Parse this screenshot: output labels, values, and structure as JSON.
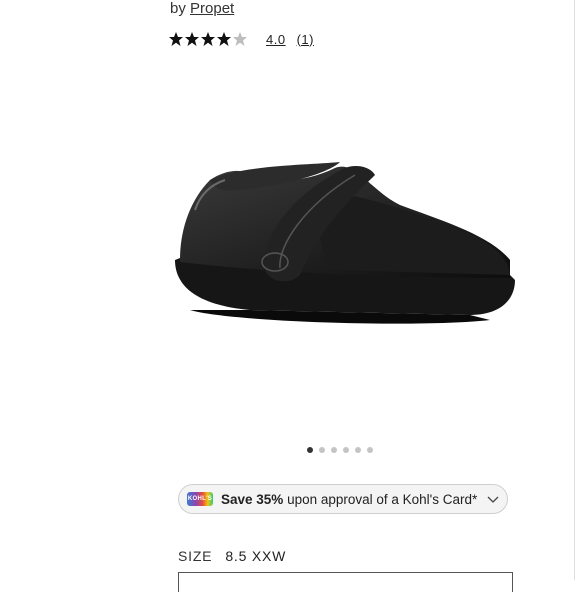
{
  "product": {
    "by_prefix": "by ",
    "brand": "Propet",
    "rating_value": "4.0",
    "review_count": "(1)",
    "stars_filled": 4,
    "stars_total": 5
  },
  "carousel": {
    "dot_count": 6,
    "active_index": 0
  },
  "promo": {
    "bold_text": "Save 35%",
    "rest_text": " upon approval of a Kohl's Card*",
    "card_icon_text": "KOHL'S"
  },
  "size": {
    "label": "SIZE",
    "value": "8.5 XXW"
  },
  "colors": {
    "star": "#111111",
    "star_empty": "#bdbdbd",
    "dot_active": "#333333",
    "dot_inactive": "#c4c4c4"
  }
}
